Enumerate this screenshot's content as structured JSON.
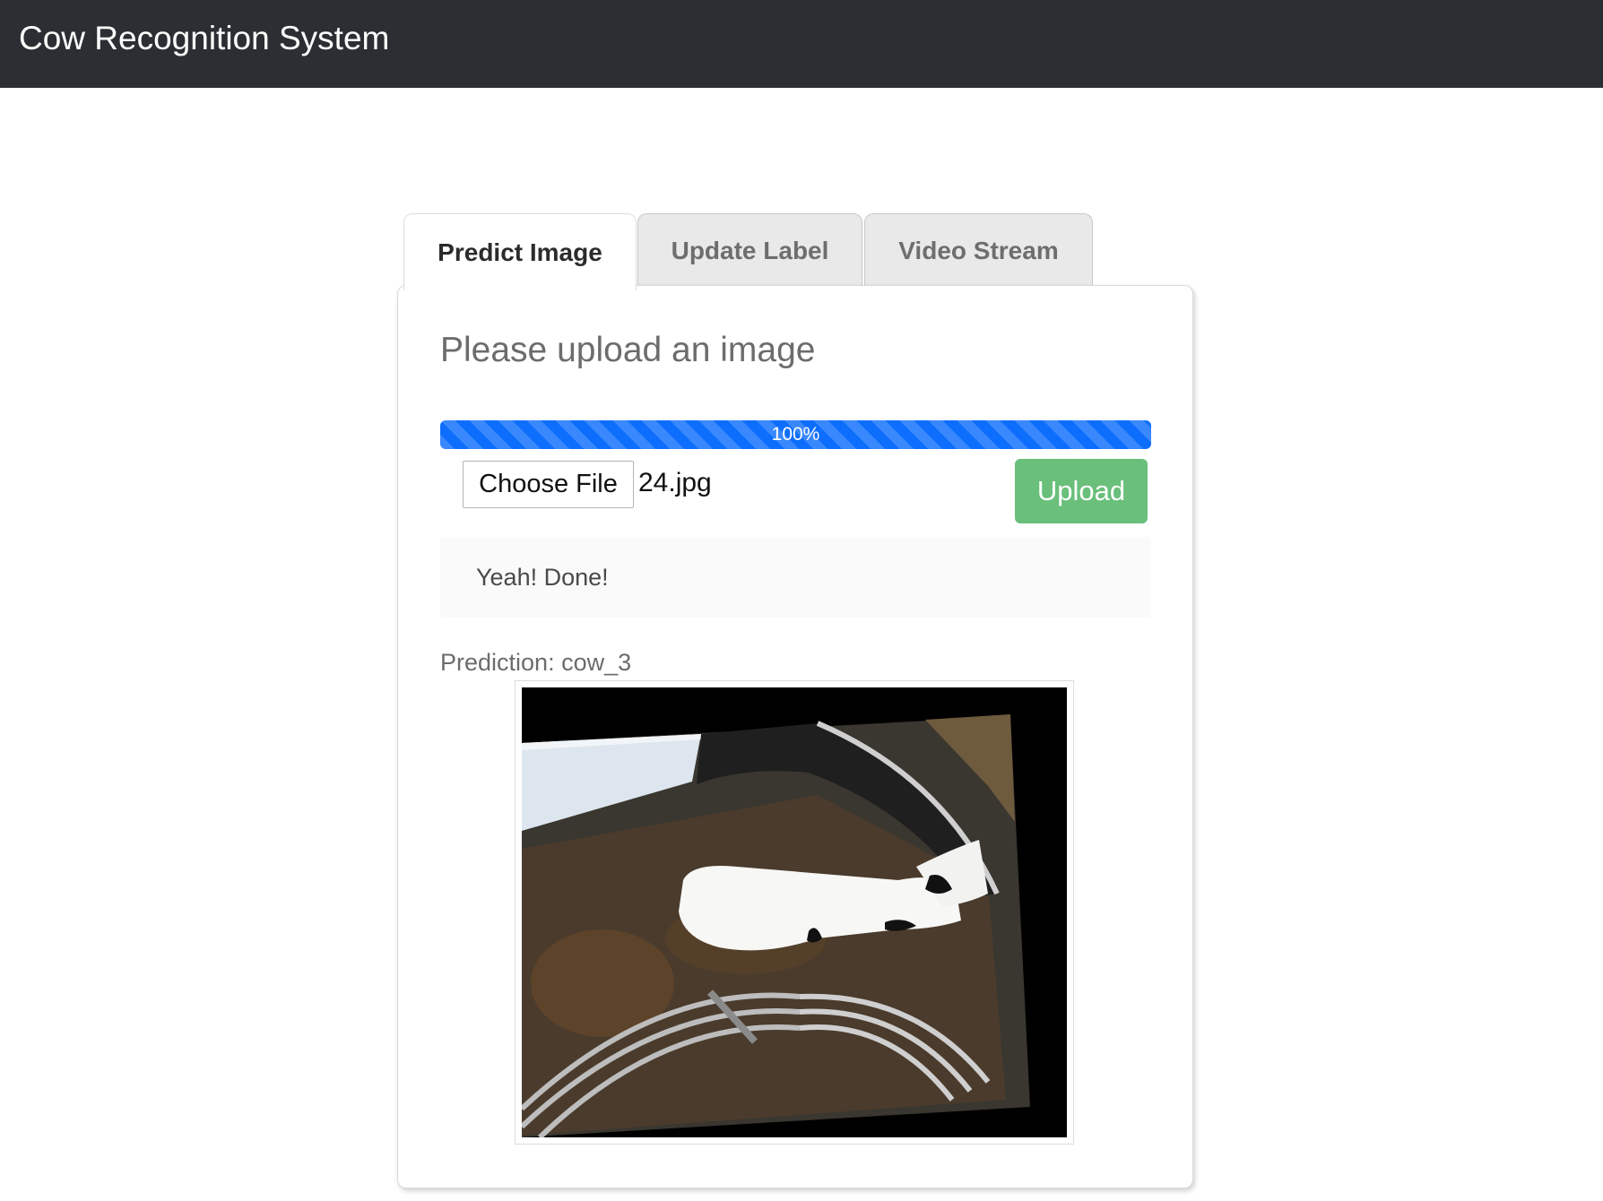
{
  "navbar": {
    "title": "Cow Recognition System"
  },
  "tabs": [
    {
      "label": "Predict Image",
      "active": true
    },
    {
      "label": "Update Label",
      "active": false
    },
    {
      "label": "Video Stream",
      "active": false
    }
  ],
  "upload": {
    "heading": "Please upload an image",
    "progress": {
      "percent": 100,
      "label": "100%"
    },
    "choose_file_label": "Choose File",
    "file_name": "24.jpg",
    "upload_button_label": "Upload",
    "status_message": "Yeah! Done!"
  },
  "result": {
    "prediction_text": "Prediction: cow_3"
  },
  "colors": {
    "navbar_bg": "#2b2f34",
    "progress_bar": "#0d6efd",
    "upload_button": "#6abf7b"
  },
  "icons": {
    "image": "cow-photo"
  }
}
